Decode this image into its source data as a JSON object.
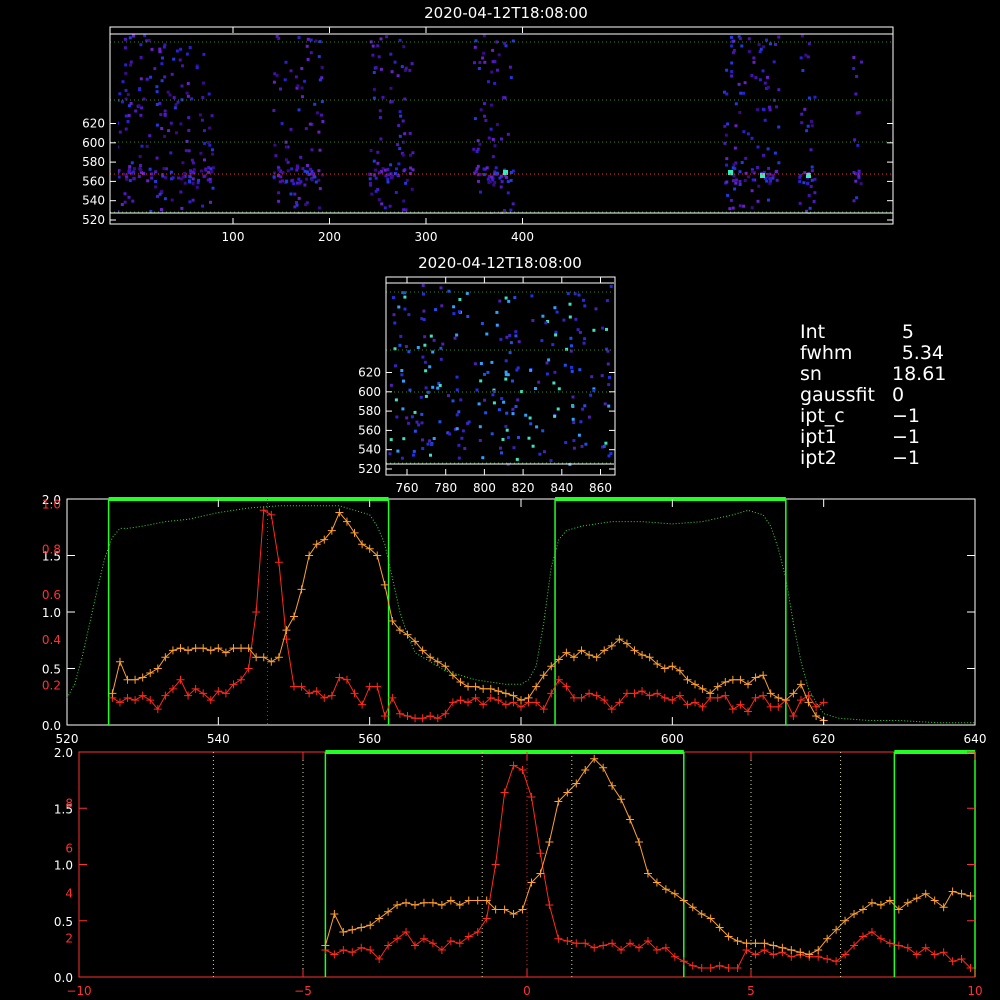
{
  "colors": {
    "background": "#000000",
    "axis": "#ffffff",
    "bottom_axis": "#ff3030",
    "grid_dotted": "#2e8b2e",
    "window_green": "#22ff22",
    "profile_red": "#ff2a1a",
    "profile_orange": "#ffa030",
    "profile_dotted_green": "#33dd33",
    "marker_dotted_yellow": "#dddd88"
  },
  "top_image": {
    "title": "2020-04-12T18:08:00",
    "x_ticks": [
      "100",
      "200",
      "300",
      "400"
    ],
    "y_ticks": [
      "520",
      "540",
      "560",
      "580",
      "600",
      "620"
    ]
  },
  "mid_image": {
    "title": "2020-04-12T18:08:00",
    "x_ticks": [
      "760",
      "780",
      "800",
      "820",
      "840",
      "860"
    ],
    "y_ticks": [
      "520",
      "540",
      "560",
      "580",
      "600",
      "620"
    ]
  },
  "info": [
    {
      "key": "Int",
      "value": "5"
    },
    {
      "key": "fwhm",
      "value": "5.34"
    },
    {
      "key": "sn",
      "value": "18.61"
    },
    {
      "key": "gaussfit",
      "value": "0"
    },
    {
      "key": "ipt_c",
      "value": "−1"
    },
    {
      "key": "ipt1",
      "value": "−1"
    },
    {
      "key": "ipt2",
      "value": "−1"
    }
  ],
  "chart_data": [
    {
      "type": "line",
      "x_ticks": [
        "520",
        "540",
        "560",
        "580",
        "600",
        "620",
        "640"
      ],
      "xlim": [
        520,
        640
      ],
      "left_axis_ticks_red": [
        "0.2",
        "0.4",
        "0.6",
        "0.8",
        "1.0"
      ],
      "left_axis_ticks_orange": [
        "0.0",
        "0.5",
        "1.0",
        "1.5",
        "2.0"
      ],
      "ylim": [
        0,
        1.0
      ],
      "windows": [
        [
          525.5,
          562.5
        ],
        [
          584.5,
          615
        ]
      ],
      "center_marker_x": 546.5,
      "series": [
        {
          "color": "red",
          "x": [
            526,
            527,
            528,
            529,
            530,
            531,
            532,
            533,
            534,
            535,
            536,
            537,
            538,
            539,
            540,
            541,
            542,
            543,
            544,
            545,
            546,
            547,
            548,
            549,
            550,
            551,
            552,
            553,
            554,
            555,
            556,
            557,
            558,
            559,
            560,
            561,
            562,
            563,
            564,
            565,
            566,
            567,
            568,
            569,
            570,
            571,
            572,
            573,
            574,
            575,
            576,
            577,
            578,
            579,
            580,
            581,
            582,
            583,
            584,
            585,
            586,
            587,
            588,
            589,
            590,
            591,
            592,
            593,
            594,
            595,
            596,
            597,
            598,
            599,
            600,
            601,
            602,
            603,
            604,
            605,
            606,
            607,
            608,
            609,
            610,
            611,
            612,
            613,
            614,
            615,
            616,
            617,
            618,
            619,
            620
          ],
          "y": [
            0.12,
            0.1,
            0.12,
            0.11,
            0.13,
            0.11,
            0.07,
            0.13,
            0.16,
            0.2,
            0.13,
            0.16,
            0.14,
            0.11,
            0.15,
            0.14,
            0.18,
            0.2,
            0.25,
            0.5,
            0.95,
            0.93,
            0.72,
            0.38,
            0.17,
            0.17,
            0.14,
            0.15,
            0.12,
            0.13,
            0.21,
            0.2,
            0.14,
            0.09,
            0.17,
            0.17,
            0.04,
            0.12,
            0.05,
            0.04,
            0.03,
            0.03,
            0.04,
            0.03,
            0.05,
            0.1,
            0.11,
            0.1,
            0.12,
            0.09,
            0.12,
            0.11,
            0.09,
            0.1,
            0.08,
            0.1,
            0.1,
            0.07,
            0.14,
            0.2,
            0.17,
            0.12,
            0.12,
            0.14,
            0.13,
            0.11,
            0.07,
            0.1,
            0.14,
            0.14,
            0.15,
            0.13,
            0.14,
            0.12,
            0.11,
            0.13,
            0.09,
            0.1,
            0.08,
            0.12,
            0.12,
            0.13,
            0.07,
            0.09,
            0.06,
            0.12,
            0.13,
            0.08,
            0.08,
            0.11,
            0.04,
            0.11,
            0.13,
            0.08,
            0.1
          ]
        },
        {
          "color": "orange",
          "x": [
            526,
            527,
            528,
            529,
            530,
            531,
            532,
            533,
            534,
            535,
            536,
            537,
            538,
            539,
            540,
            541,
            542,
            543,
            544,
            545,
            546,
            547,
            548,
            549,
            550,
            551,
            552,
            553,
            554,
            555,
            556,
            557,
            558,
            559,
            560,
            561,
            562,
            563,
            564,
            565,
            566,
            567,
            568,
            569,
            570,
            571,
            572,
            573,
            574,
            575,
            576,
            577,
            578,
            579,
            580,
            581,
            582,
            583,
            584,
            585,
            586,
            587,
            588,
            589,
            590,
            591,
            592,
            593,
            594,
            595,
            596,
            597,
            598,
            599,
            600,
            601,
            602,
            603,
            604,
            605,
            606,
            607,
            608,
            609,
            610,
            611,
            612,
            613,
            614,
            615,
            616,
            617,
            618,
            619,
            620
          ],
          "y": [
            0.14,
            0.28,
            0.2,
            0.2,
            0.21,
            0.23,
            0.25,
            0.3,
            0.33,
            0.34,
            0.33,
            0.34,
            0.34,
            0.33,
            0.34,
            0.32,
            0.34,
            0.34,
            0.34,
            0.3,
            0.3,
            0.28,
            0.3,
            0.42,
            0.48,
            0.6,
            0.75,
            0.8,
            0.82,
            0.86,
            0.94,
            0.9,
            0.85,
            0.8,
            0.78,
            0.75,
            0.62,
            0.46,
            0.42,
            0.4,
            0.37,
            0.33,
            0.3,
            0.28,
            0.26,
            0.22,
            0.19,
            0.17,
            0.17,
            0.16,
            0.16,
            0.15,
            0.14,
            0.13,
            0.11,
            0.12,
            0.17,
            0.22,
            0.26,
            0.29,
            0.32,
            0.3,
            0.33,
            0.31,
            0.3,
            0.33,
            0.35,
            0.38,
            0.36,
            0.33,
            0.31,
            0.3,
            0.27,
            0.25,
            0.26,
            0.24,
            0.2,
            0.18,
            0.16,
            0.14,
            0.17,
            0.19,
            0.2,
            0.2,
            0.18,
            0.21,
            0.22,
            0.14,
            0.12,
            0.11,
            0.14,
            0.18,
            0.1,
            0.04,
            0.02
          ]
        },
        {
          "color": "dotted-green",
          "x": [
            520,
            521,
            522,
            523,
            524,
            525,
            526,
            527,
            528,
            530,
            533,
            536,
            540,
            544,
            548,
            552,
            556,
            558,
            560,
            561,
            562,
            563,
            564,
            565,
            566,
            568,
            570,
            572,
            574,
            576,
            578,
            580,
            581,
            582,
            583,
            584,
            585,
            586,
            588,
            592,
            596,
            600,
            604,
            608,
            610,
            612,
            613,
            614,
            615,
            616,
            617,
            618,
            619,
            620,
            622,
            626,
            630,
            635,
            640
          ],
          "y": [
            0.12,
            0.18,
            0.3,
            0.45,
            0.6,
            0.74,
            0.83,
            0.87,
            0.87,
            0.88,
            0.9,
            0.91,
            0.94,
            0.96,
            0.97,
            0.97,
            0.97,
            0.95,
            0.93,
            0.88,
            0.8,
            0.65,
            0.5,
            0.4,
            0.32,
            0.28,
            0.24,
            0.22,
            0.2,
            0.19,
            0.18,
            0.18,
            0.2,
            0.26,
            0.45,
            0.7,
            0.82,
            0.86,
            0.88,
            0.9,
            0.9,
            0.89,
            0.9,
            0.93,
            0.95,
            0.93,
            0.88,
            0.78,
            0.65,
            0.45,
            0.28,
            0.16,
            0.1,
            0.05,
            0.03,
            0.02,
            0.02,
            0.01,
            0.01
          ]
        }
      ]
    },
    {
      "type": "line",
      "x_ticks": [
        "−10",
        "−5",
        "0",
        "5",
        "10"
      ],
      "xlim": [
        -10,
        10
      ],
      "left_axis_ticks_red": [
        "2",
        "4",
        "6",
        "8"
      ],
      "left_axis_ticks_orange": [
        "0.0",
        "0.5",
        "1.0",
        "1.5",
        "2.0"
      ],
      "ylim": [
        0,
        1.0
      ],
      "windows": [
        [
          -4.5,
          3.5
        ],
        [
          8.2,
          10
        ]
      ],
      "dotted_markers_x": [
        -7.0,
        -5.0,
        -1.0,
        1.0,
        5.0,
        7.0
      ],
      "center_marker_x": 0.0,
      "series": [
        {
          "color": "red",
          "x": [
            -4.5,
            -4.3,
            -4.1,
            -3.9,
            -3.7,
            -3.5,
            -3.3,
            -3.1,
            -2.9,
            -2.7,
            -2.5,
            -2.3,
            -2.1,
            -1.9,
            -1.7,
            -1.5,
            -1.3,
            -1.1,
            -0.9,
            -0.7,
            -0.5,
            -0.3,
            -0.1,
            0.1,
            0.3,
            0.5,
            0.7,
            0.9,
            1.1,
            1.3,
            1.5,
            1.7,
            1.9,
            2.1,
            2.3,
            2.5,
            2.7,
            2.9,
            3.1,
            3.3,
            3.5,
            3.7,
            3.9,
            4.1,
            4.3,
            4.5,
            4.7,
            4.9,
            5.1,
            5.3,
            5.5,
            5.7,
            5.9,
            6.1,
            6.3,
            6.5,
            6.7,
            6.9,
            7.1,
            7.3,
            7.5,
            7.7,
            7.9,
            8.1,
            8.3,
            8.5,
            8.7,
            8.9,
            9.1,
            9.3,
            9.5,
            9.7,
            9.9
          ],
          "y": [
            0.12,
            0.1,
            0.12,
            0.11,
            0.13,
            0.12,
            0.08,
            0.14,
            0.17,
            0.2,
            0.14,
            0.17,
            0.15,
            0.12,
            0.16,
            0.15,
            0.18,
            0.2,
            0.26,
            0.5,
            0.82,
            0.94,
            0.92,
            0.8,
            0.55,
            0.32,
            0.17,
            0.16,
            0.15,
            0.15,
            0.13,
            0.14,
            0.15,
            0.12,
            0.15,
            0.13,
            0.16,
            0.12,
            0.13,
            0.09,
            0.07,
            0.05,
            0.04,
            0.04,
            0.05,
            0.04,
            0.04,
            0.12,
            0.1,
            0.12,
            0.1,
            0.11,
            0.09,
            0.1,
            0.09,
            0.09,
            0.08,
            0.07,
            0.1,
            0.14,
            0.18,
            0.2,
            0.17,
            0.15,
            0.14,
            0.13,
            0.1,
            0.13,
            0.1,
            0.11,
            0.07,
            0.08,
            0.04
          ]
        },
        {
          "color": "orange",
          "x": [
            -4.5,
            -4.3,
            -4.1,
            -3.9,
            -3.7,
            -3.5,
            -3.3,
            -3.1,
            -2.9,
            -2.7,
            -2.5,
            -2.3,
            -2.1,
            -1.9,
            -1.7,
            -1.5,
            -1.3,
            -1.1,
            -0.9,
            -0.7,
            -0.5,
            -0.3,
            -0.1,
            0.1,
            0.3,
            0.5,
            0.7,
            0.9,
            1.1,
            1.3,
            1.5,
            1.7,
            1.9,
            2.1,
            2.3,
            2.5,
            2.7,
            2.9,
            3.1,
            3.3,
            3.5,
            3.7,
            3.9,
            4.1,
            4.3,
            4.5,
            4.7,
            4.9,
            5.1,
            5.3,
            5.5,
            5.7,
            5.9,
            6.1,
            6.3,
            6.5,
            6.7,
            6.9,
            7.1,
            7.3,
            7.5,
            7.7,
            7.9,
            8.1,
            8.3,
            8.5,
            8.7,
            8.9,
            9.1,
            9.3,
            9.5,
            9.7,
            9.9
          ],
          "y": [
            0.14,
            0.28,
            0.2,
            0.21,
            0.22,
            0.23,
            0.26,
            0.29,
            0.32,
            0.33,
            0.32,
            0.33,
            0.33,
            0.32,
            0.34,
            0.32,
            0.34,
            0.34,
            0.34,
            0.3,
            0.3,
            0.28,
            0.3,
            0.42,
            0.46,
            0.6,
            0.78,
            0.82,
            0.86,
            0.92,
            0.97,
            0.93,
            0.85,
            0.79,
            0.7,
            0.6,
            0.46,
            0.42,
            0.39,
            0.37,
            0.34,
            0.31,
            0.28,
            0.26,
            0.22,
            0.18,
            0.16,
            0.15,
            0.15,
            0.15,
            0.14,
            0.13,
            0.12,
            0.11,
            0.1,
            0.12,
            0.17,
            0.21,
            0.25,
            0.28,
            0.3,
            0.33,
            0.32,
            0.34,
            0.3,
            0.33,
            0.35,
            0.37,
            0.34,
            0.31,
            0.38,
            0.37,
            0.36
          ]
        }
      ]
    }
  ]
}
